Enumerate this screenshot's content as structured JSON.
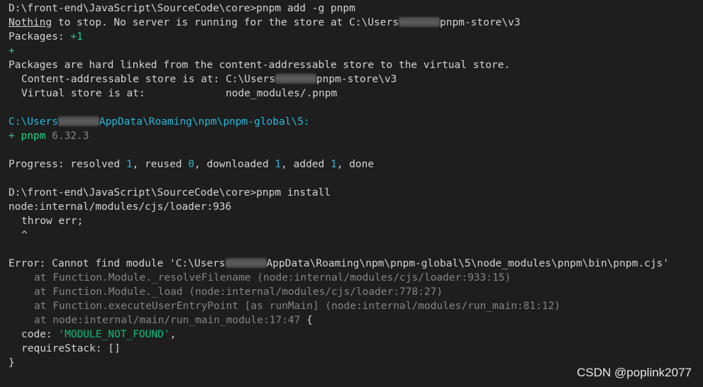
{
  "terminal": {
    "l1": "D:\\front-end\\JavaScript\\SourceCode\\core>pnpm add -g pnpm",
    "l2_underlined": "Nothing",
    "l2_a": " to stop. No server is running for the store at C:\\Users",
    "l2_b": "pnpm-store\\v3",
    "l3_a": "Packages: ",
    "l3_b": "+1",
    "l4": "+",
    "l5": "Packages are hard linked from the content-addressable store to the virtual store.",
    "l6_a": "Content-addressable store is at: C:\\Users",
    "l6_b": "pnpm-store\\v3",
    "l7_a": "Virtual store is at:             node_modules",
    "l7_b": "/.pnpm",
    "l9_a": "C:\\Users",
    "l9_b": "AppData\\Roaming\\npm\\pnpm-global\\5:",
    "l10_a": "+ pnpm ",
    "l10_b": "6.32.3",
    "l12_a": "Progress: resolved ",
    "l12_n1": "1",
    "l12_b": ", reused ",
    "l12_n2": "0",
    "l12_c": ", downloaded ",
    "l12_n3": "1",
    "l12_d": ", added ",
    "l12_n4": "1",
    "l12_e": ", done",
    "l14": "D:\\front-end\\JavaScript\\SourceCode\\core>pnpm install",
    "l15": "node:internal/modules/cjs/loader:936",
    "l16": "throw err;",
    "l17": "^",
    "l19_a": "Error: Cannot find module 'C:\\Users",
    "l19_b": "AppData\\Roaming\\npm\\pnpm-global\\5\\node_modules\\pnpm\\bin\\pnpm.cjs'",
    "l20": "at Function.Module._resolveFilename (node:internal/modules/cjs/loader:933:15)",
    "l21": "at Function.Module._load (node:internal/modules/cjs/loader:778:27)",
    "l22": "at Function.executeUserEntryPoint [as runMain] (node:internal/modules/run_main:81:12)",
    "l23_a": "at node:internal/main/run_main_module:17:47",
    "l23_b": " {",
    "l24_a": "code: ",
    "l24_b": "'MODULE_NOT_FOUND'",
    "l24_c": ",",
    "l25": "requireStack: []",
    "l26": "}"
  },
  "watermark": "CSDN @poplink2077",
  "colors": {
    "background": "#1e1e1e",
    "text": "#d4d4d4",
    "green": "#23d18b",
    "cyan": "#29b8db",
    "gray": "#858585",
    "string": "#0dbc79"
  }
}
